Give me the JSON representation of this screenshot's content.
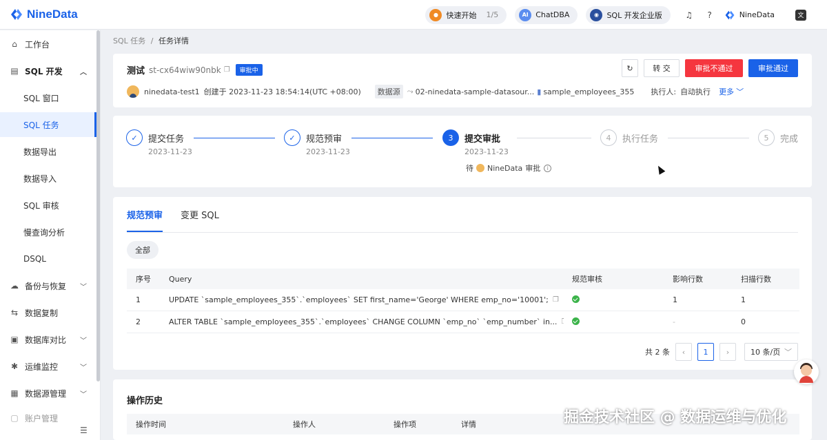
{
  "app": {
    "name": "NineData"
  },
  "topbar": {
    "quickstart_label": "快速开始",
    "quickstart_progress": "1/5",
    "chatdba_label": "ChatDBA",
    "edition_label": "SQL 开发企业版",
    "user_label": "NineData",
    "lang_glyph": "文"
  },
  "sidebar": {
    "items": [
      {
        "label": "工作台"
      },
      {
        "label": "SQL 开发"
      },
      {
        "label": "SQL 窗口"
      },
      {
        "label": "SQL 任务"
      },
      {
        "label": "数据导出"
      },
      {
        "label": "数据导入"
      },
      {
        "label": "SQL 审核"
      },
      {
        "label": "慢查询分析"
      },
      {
        "label": "DSQL"
      },
      {
        "label": "备份与恢复"
      },
      {
        "label": "数据复制"
      },
      {
        "label": "数据库对比"
      },
      {
        "label": "运维监控"
      },
      {
        "label": "数据源管理"
      },
      {
        "label": "账户管理"
      }
    ]
  },
  "breadcrumb": {
    "parent": "SQL 任务",
    "sep": "/",
    "current": "任务详情"
  },
  "task": {
    "name": "测试",
    "id": "st-cx64wiw90nbk",
    "status": "审批中",
    "creator": "ninedata-test1",
    "created_text": "创建于 2023-11-23 18:54:14(UTC +08:00)",
    "datasource_label": "数据源",
    "datasource": "02-ninedata-sample-datasour...",
    "database": "sample_employees_355",
    "executor_label": "执行人:",
    "executor": "自动执行",
    "more": "更多"
  },
  "actions": {
    "transfer": "转 交",
    "reject": "审批不通过",
    "approve": "审批通过"
  },
  "steps": [
    {
      "num": "1",
      "title": "提交任务",
      "date": "2023-11-23",
      "state": "done"
    },
    {
      "num": "2",
      "title": "规范预审",
      "date": "2023-11-23",
      "state": "done"
    },
    {
      "num": "3",
      "title": "提交审批",
      "date": "2023-11-23",
      "state": "current"
    },
    {
      "num": "4",
      "title": "执行任务",
      "date": "",
      "state": "todo"
    },
    {
      "num": "5",
      "title": "完成",
      "date": "",
      "state": "todo"
    }
  ],
  "waiting": {
    "prefix": "待",
    "who": "NineData",
    "suffix": "审批"
  },
  "tabs": [
    {
      "label": "规范预审"
    },
    {
      "label": "变更 SQL"
    }
  ],
  "filter": {
    "label": "全部"
  },
  "table": {
    "headers": [
      "序号",
      "Query",
      "规范审核",
      "影响行数",
      "扫描行数"
    ],
    "rows": [
      {
        "no": "1",
        "query": "UPDATE `sample_employees_355`.`employees` SET first_name='George' WHERE emp_no='10001';",
        "check": "pass",
        "affected": "1",
        "scanned": "1"
      },
      {
        "no": "2",
        "query": "ALTER TABLE `sample_employees_355`.`employees` CHANGE COLUMN `emp_no` `emp_number` in...",
        "check": "pass",
        "affected": "-",
        "scanned": "0"
      }
    ]
  },
  "pagination": {
    "total": "共 2 条",
    "current": "1",
    "page_size": "10 条/页"
  },
  "history": {
    "title": "操作历史",
    "headers": [
      "操作时间",
      "操作人",
      "操作项",
      "详情"
    ]
  },
  "watermark": "掘金技术社区 @ 数据运维与优化",
  "colors": {
    "primary": "#1a62e8",
    "danger": "#f5363f",
    "success": "#3bb34a"
  }
}
